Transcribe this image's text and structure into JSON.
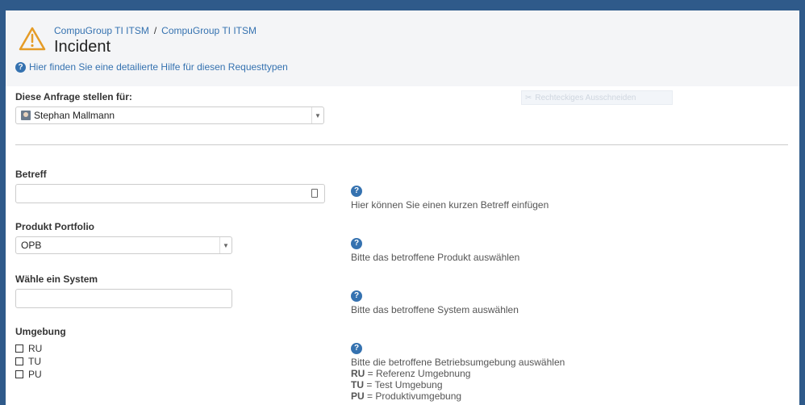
{
  "header": {
    "breadcrumb": [
      "CompuGroup TI ITSM",
      "CompuGroup TI ITSM"
    ],
    "breadcrumb_sep": "/",
    "title": "Incident",
    "help_link": "Hier finden Sie eine detailierte Hilfe für diesen Requesttypen"
  },
  "ghost_overlay": {
    "label": "Rechteckiges Ausschneiden"
  },
  "form": {
    "request_for": {
      "label": "Diese Anfrage stellen für:",
      "value": "Stephan Mallmann"
    },
    "subject": {
      "label": "Betreff",
      "value": "",
      "help": "Hier können Sie einen kurzen Betreff einfügen"
    },
    "portfolio": {
      "label": "Produkt Portfolio",
      "value": "OPB",
      "help": "Bitte das betroffene Produkt auswählen"
    },
    "system": {
      "label": "Wähle ein System",
      "value": "",
      "help": "Bitte das betroffene System auswählen"
    },
    "environment": {
      "label": "Umgebung",
      "options": [
        "RU",
        "TU",
        "PU"
      ],
      "help": "Bitte die betroffene Betriebsumgebung auswählen",
      "legend": [
        {
          "key": "RU",
          "text": " = Referenz Umgebnung"
        },
        {
          "key": "TU",
          "text": " = Test Umgebung"
        },
        {
          "key": "PU",
          "text": " = Produktivumgebung"
        }
      ]
    }
  },
  "colors": {
    "accent": "#3572b0",
    "warning": "#e59c27",
    "page_bg": "#2f5a8a"
  }
}
